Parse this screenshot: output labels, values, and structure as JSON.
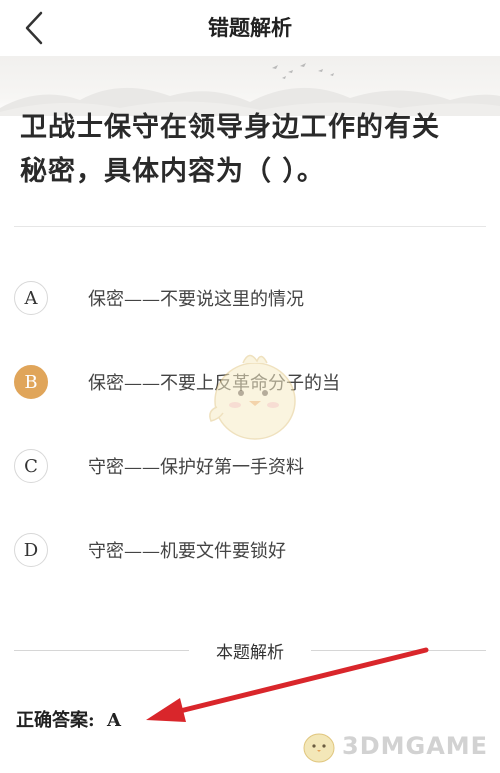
{
  "header": {
    "title": "错题解析",
    "back_icon": "chevron-left-icon"
  },
  "question": {
    "text": "卫战士保守在领导身边工作的有关秘密，具体内容为（    ）。"
  },
  "options": [
    {
      "letter": "A",
      "text": "保密——不要说这里的情况",
      "selected": false
    },
    {
      "letter": "B",
      "text": "保密——不要上反革命分子的当",
      "selected": true
    },
    {
      "letter": "C",
      "text": "守密——保护好第一手资料",
      "selected": false
    },
    {
      "letter": "D",
      "text": "守密——机要文件要锁好",
      "selected": false
    }
  ],
  "analysis": {
    "section_title": "本题解析",
    "answer_label": "正确答案:",
    "answer_value": "A"
  },
  "watermark": {
    "text": "3DMGAME"
  },
  "colors": {
    "selected_option": "#e0a55a",
    "annotation_arrow": "#d9262b"
  }
}
